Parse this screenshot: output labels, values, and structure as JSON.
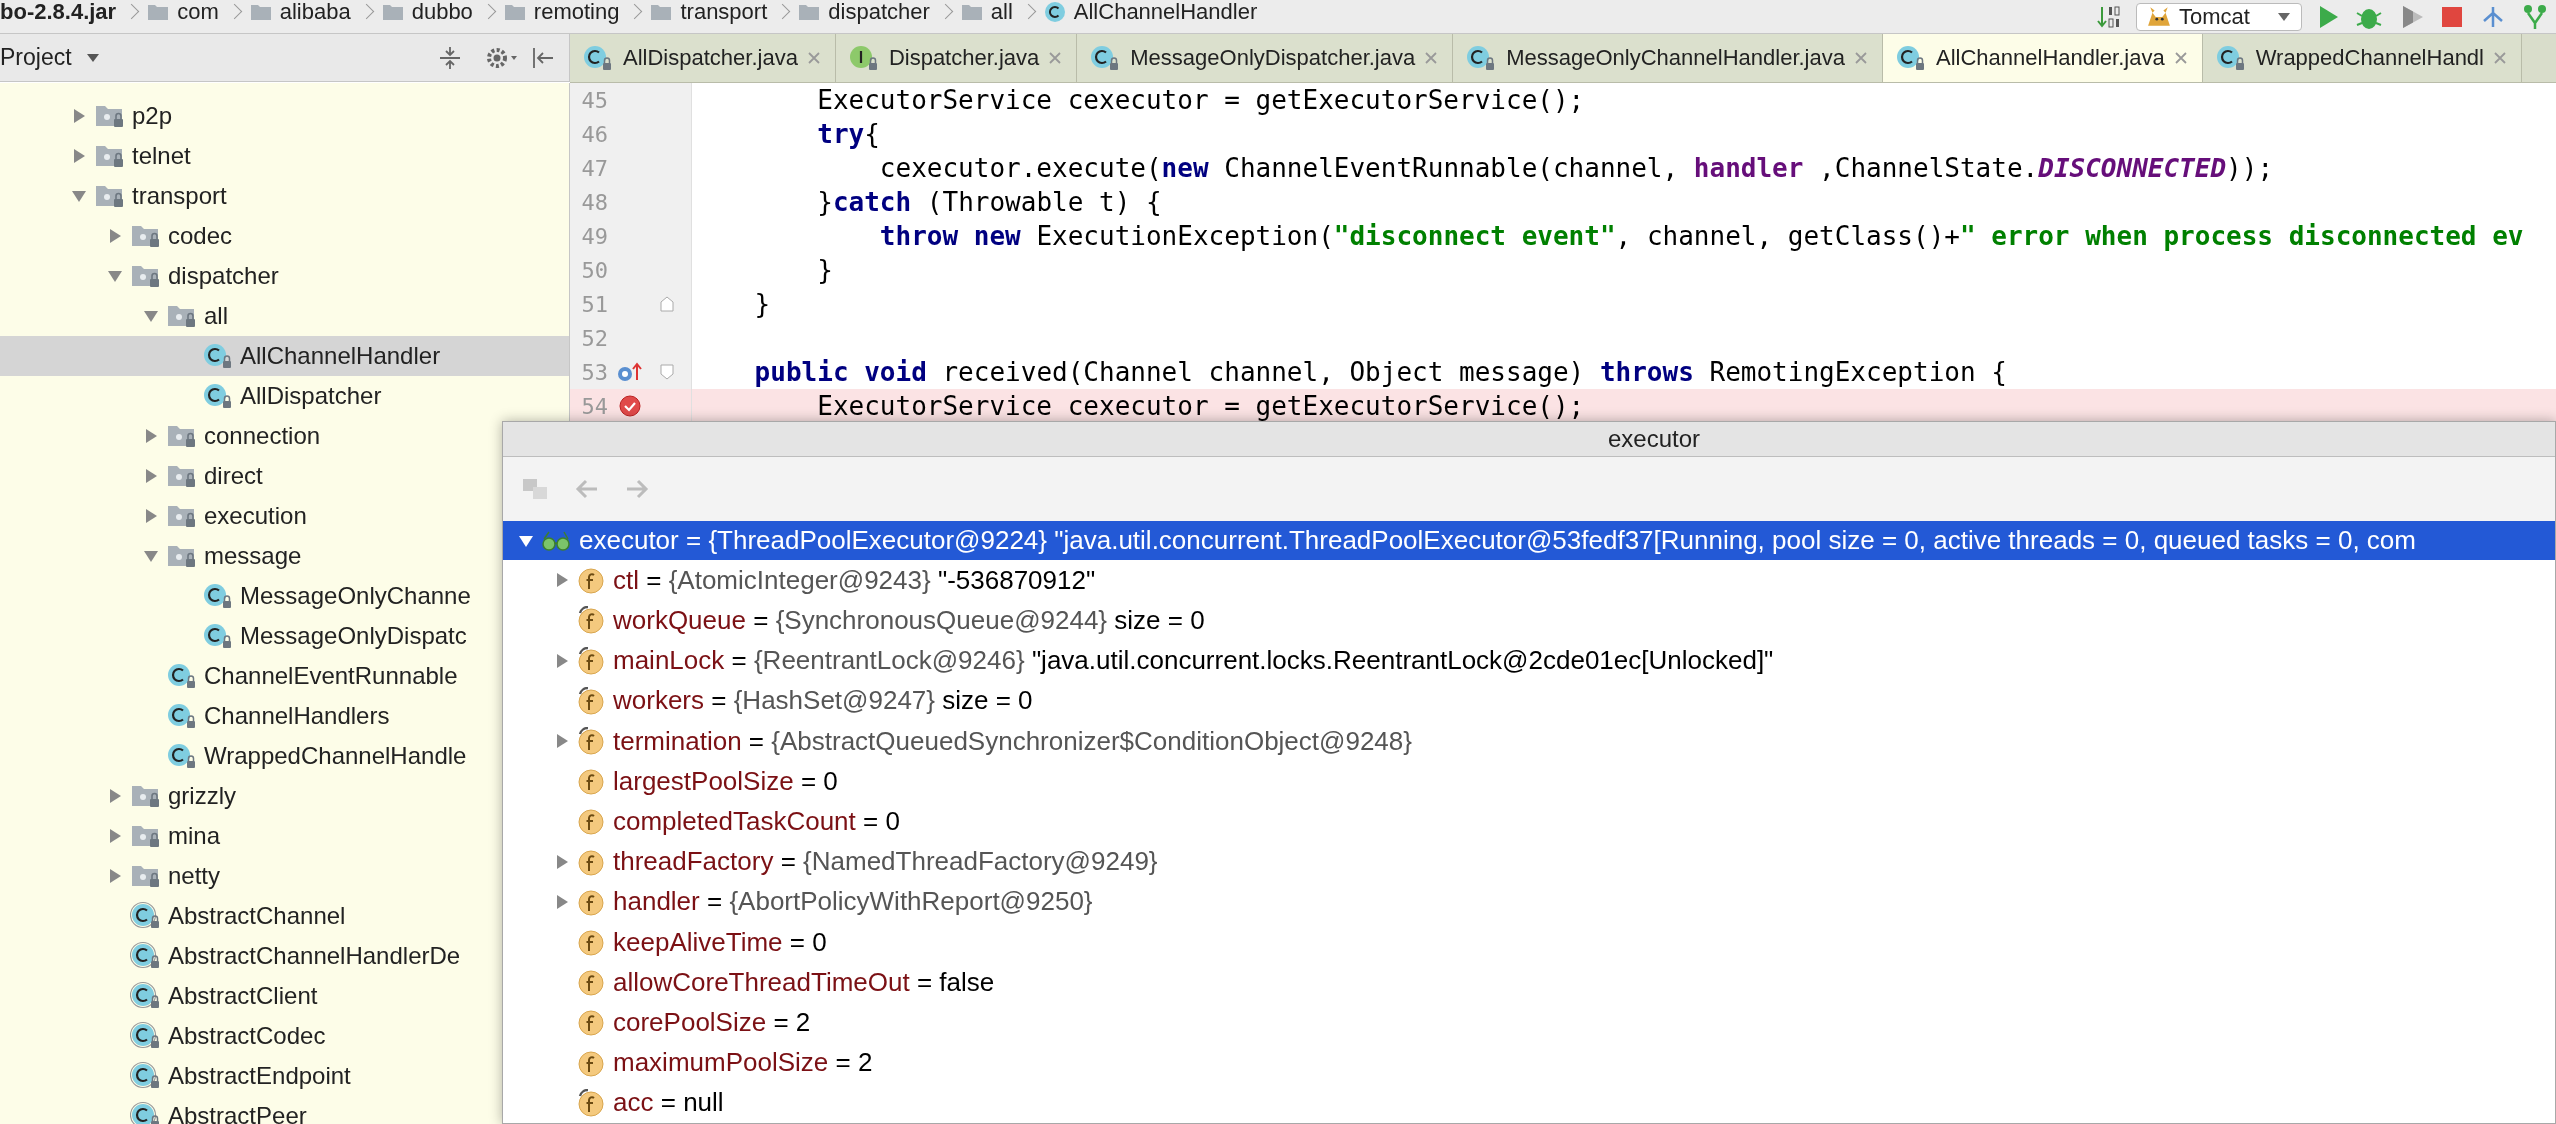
{
  "breadcrumbs": [
    {
      "label": "bo-2.8.4.jar",
      "kind": "jar"
    },
    {
      "label": "com",
      "kind": "package"
    },
    {
      "label": "alibaba",
      "kind": "package"
    },
    {
      "label": "dubbo",
      "kind": "package"
    },
    {
      "label": "remoting",
      "kind": "package"
    },
    {
      "label": "transport",
      "kind": "package"
    },
    {
      "label": "dispatcher",
      "kind": "package"
    },
    {
      "label": "all",
      "kind": "package"
    },
    {
      "label": "AllChannelHandler",
      "kind": "class"
    }
  ],
  "run_config": {
    "label": "Tomcat"
  },
  "project_panel": {
    "title": "Project",
    "tree": [
      {
        "label": "p2p",
        "kind": "package",
        "expanded": false,
        "selected": false
      },
      {
        "label": "telnet",
        "kind": "package",
        "expanded": false,
        "selected": false
      },
      {
        "label": "transport",
        "kind": "package",
        "expanded": true,
        "selected": false,
        "children": [
          {
            "label": "codec",
            "kind": "package",
            "expanded": false,
            "selected": false
          },
          {
            "label": "dispatcher",
            "kind": "package",
            "expanded": true,
            "selected": false,
            "children": [
              {
                "label": "all",
                "kind": "package",
                "expanded": true,
                "selected": false,
                "children": [
                  {
                    "label": "AllChannelHandler",
                    "kind": "class",
                    "selected": true
                  },
                  {
                    "label": "AllDispatcher",
                    "kind": "class",
                    "selected": false
                  }
                ]
              },
              {
                "label": "connection",
                "kind": "package",
                "expanded": false,
                "selected": false
              },
              {
                "label": "direct",
                "kind": "package",
                "expanded": false,
                "selected": false
              },
              {
                "label": "execution",
                "kind": "package",
                "expanded": false,
                "selected": false
              },
              {
                "label": "message",
                "kind": "package",
                "expanded": true,
                "selected": false,
                "children": [
                  {
                    "label": "MessageOnlyChanne",
                    "kind": "class",
                    "selected": false
                  },
                  {
                    "label": "MessageOnlyDispatc",
                    "kind": "class",
                    "selected": false
                  }
                ]
              },
              {
                "label": "ChannelEventRunnable",
                "kind": "class",
                "selected": false
              },
              {
                "label": "ChannelHandlers",
                "kind": "class",
                "selected": false
              },
              {
                "label": "WrappedChannelHandle",
                "kind": "class",
                "selected": false
              }
            ]
          },
          {
            "label": "grizzly",
            "kind": "package",
            "expanded": false,
            "selected": false
          },
          {
            "label": "mina",
            "kind": "package",
            "expanded": false,
            "selected": false
          },
          {
            "label": "netty",
            "kind": "package",
            "expanded": false,
            "selected": false
          },
          {
            "label": "AbstractChannel",
            "kind": "abstract_class",
            "selected": false
          },
          {
            "label": "AbstractChannelHandlerDe",
            "kind": "abstract_class",
            "selected": false
          },
          {
            "label": "AbstractClient",
            "kind": "abstract_class",
            "selected": false
          },
          {
            "label": "AbstractCodec",
            "kind": "abstract_class",
            "selected": false
          },
          {
            "label": "AbstractEndpoint",
            "kind": "abstract_class",
            "selected": false
          },
          {
            "label": "AbstractPeer",
            "kind": "abstract_class",
            "selected": false
          }
        ]
      }
    ]
  },
  "tabs": [
    {
      "label": "AllDispatcher.java",
      "kind": "class",
      "selected": false
    },
    {
      "label": "Dispatcher.java",
      "kind": "interface",
      "selected": false
    },
    {
      "label": "MessageOnlyDispatcher.java",
      "kind": "class",
      "selected": false
    },
    {
      "label": "MessageOnlyChannelHandler.java",
      "kind": "class",
      "selected": false
    },
    {
      "label": "AllChannelHandler.java",
      "kind": "class",
      "selected": true
    },
    {
      "label": "WrappedChannelHandl",
      "kind": "class",
      "selected": false
    }
  ],
  "editor": {
    "lines": [
      {
        "number": "45",
        "breakpoint": false,
        "override": false,
        "fold_start": false,
        "fold_end": false,
        "highlighted": false,
        "tokens": [
          {
            "kind": "plain",
            "text": "        ExecutorService cexecutor = getExecutorService();"
          }
        ]
      },
      {
        "number": "46",
        "breakpoint": false,
        "override": false,
        "fold_start": false,
        "fold_end": false,
        "highlighted": false,
        "tokens": [
          {
            "kind": "keyword",
            "text": "        try"
          },
          {
            "kind": "plain",
            "text": "{"
          }
        ]
      },
      {
        "number": "47",
        "breakpoint": false,
        "override": false,
        "fold_start": false,
        "fold_end": false,
        "highlighted": false,
        "tokens": [
          {
            "kind": "plain",
            "text": "            cexecutor.execute("
          },
          {
            "kind": "keyword",
            "text": "new"
          },
          {
            "kind": "plain",
            "text": " ChannelEventRunnable(channel, "
          },
          {
            "kind": "field",
            "text": "handler"
          },
          {
            "kind": "plain",
            "text": " ,ChannelState."
          },
          {
            "kind": "constant",
            "text": "DISCONNECTED"
          },
          {
            "kind": "plain",
            "text": "));"
          }
        ]
      },
      {
        "number": "48",
        "breakpoint": false,
        "override": false,
        "fold_start": false,
        "fold_end": false,
        "highlighted": false,
        "tokens": [
          {
            "kind": "plain",
            "text": "        }"
          },
          {
            "kind": "keyword",
            "text": "catch"
          },
          {
            "kind": "plain",
            "text": " (Throwable t) {"
          }
        ]
      },
      {
        "number": "49",
        "breakpoint": false,
        "override": false,
        "fold_start": false,
        "fold_end": false,
        "highlighted": false,
        "tokens": [
          {
            "kind": "keyword",
            "text": "            throw new"
          },
          {
            "kind": "plain",
            "text": " ExecutionException("
          },
          {
            "kind": "string",
            "text": "\"disconnect event\""
          },
          {
            "kind": "plain",
            "text": ", channel, getClass()+"
          },
          {
            "kind": "string",
            "text": "\" error when process disconnected ev"
          }
        ]
      },
      {
        "number": "50",
        "breakpoint": false,
        "override": false,
        "fold_start": false,
        "fold_end": false,
        "highlighted": false,
        "tokens": [
          {
            "kind": "plain",
            "text": "        }"
          }
        ]
      },
      {
        "number": "51",
        "breakpoint": false,
        "override": false,
        "fold_start": false,
        "fold_end": true,
        "highlighted": false,
        "tokens": [
          {
            "kind": "plain",
            "text": "    }"
          }
        ]
      },
      {
        "number": "52",
        "breakpoint": false,
        "override": false,
        "fold_start": false,
        "fold_end": false,
        "highlighted": false
      },
      {
        "number": "53",
        "breakpoint": false,
        "override": true,
        "fold_start": true,
        "fold_end": false,
        "highlighted": false,
        "tokens": [
          {
            "kind": "keyword",
            "text": "    public void"
          },
          {
            "kind": "plain",
            "text": " received(Channel channel, Object message) "
          },
          {
            "kind": "keyword",
            "text": "throws"
          },
          {
            "kind": "plain",
            "text": " RemotingException {"
          }
        ]
      },
      {
        "number": "54",
        "breakpoint": true,
        "override": false,
        "fold_start": false,
        "fold_end": false,
        "highlighted": true,
        "tokens": [
          {
            "kind": "plain",
            "text": "        ExecutorService cexecutor = getExecutorService();"
          }
        ]
      }
    ]
  },
  "popup": {
    "title": "executor",
    "variables": [
      {
        "name": "executor",
        "operator": "=",
        "ref": "{ThreadPoolExecutor@9224}",
        "value": "\"java.util.concurrent.ThreadPoolExecutor@53fedf37[Running, pool size = 0, active threads = 0, queued tasks = 0, com",
        "kind": "watch",
        "expanded": true,
        "selected": true,
        "children": [
          {
            "name": "ctl",
            "operator": "=",
            "ref": "{AtomicInteger@9243}",
            "value": "\"-536870912\"",
            "kind": "field",
            "expanded": false,
            "selected": false,
            "final": false
          },
          {
            "name": "workQueue",
            "operator": "=",
            "ref": "{SynchronousQueue@9244}",
            "value": "size = 0",
            "kind": "field",
            "selected": false,
            "final": true
          },
          {
            "name": "mainLock",
            "operator": "=",
            "ref": "{ReentrantLock@9246}",
            "value": "\"java.util.concurrent.locks.ReentrantLock@2cde01ec[Unlocked]\"",
            "kind": "field",
            "expanded": false,
            "selected": false,
            "final": true
          },
          {
            "name": "workers",
            "operator": "=",
            "ref": "{HashSet@9247}",
            "value": "size = 0",
            "kind": "field",
            "selected": false,
            "final": true
          },
          {
            "name": "termination",
            "operator": "=",
            "ref": "{AbstractQueuedSynchronizer$ConditionObject@9248}",
            "kind": "field",
            "expanded": false,
            "selected": false,
            "final": true
          },
          {
            "name": "largestPoolSize",
            "operator": "=",
            "value": "0",
            "kind": "field",
            "selected": false,
            "final": false
          },
          {
            "name": "completedTaskCount",
            "operator": "=",
            "value": "0",
            "kind": "field",
            "selected": false,
            "final": false
          },
          {
            "name": "threadFactory",
            "operator": "=",
            "ref": "{NamedThreadFactory@9249}",
            "kind": "field",
            "expanded": false,
            "selected": false,
            "final": false
          },
          {
            "name": "handler",
            "operator": "=",
            "ref": "{AbortPolicyWithReport@9250}",
            "kind": "field",
            "expanded": false,
            "selected": false,
            "final": false
          },
          {
            "name": "keepAliveTime",
            "operator": "=",
            "value": "0",
            "kind": "field",
            "selected": false,
            "final": false
          },
          {
            "name": "allowCoreThreadTimeOut",
            "operator": "=",
            "value": "false",
            "kind": "field",
            "selected": false,
            "final": false
          },
          {
            "name": "corePoolSize",
            "operator": "=",
            "value": "2",
            "kind": "field",
            "selected": false,
            "final": false
          },
          {
            "name": "maximumPoolSize",
            "operator": "=",
            "value": "2",
            "kind": "field",
            "selected": false,
            "final": false
          },
          {
            "name": "acc",
            "operator": "=",
            "value": "null",
            "kind": "field",
            "selected": false,
            "final": true
          }
        ]
      }
    ]
  }
}
